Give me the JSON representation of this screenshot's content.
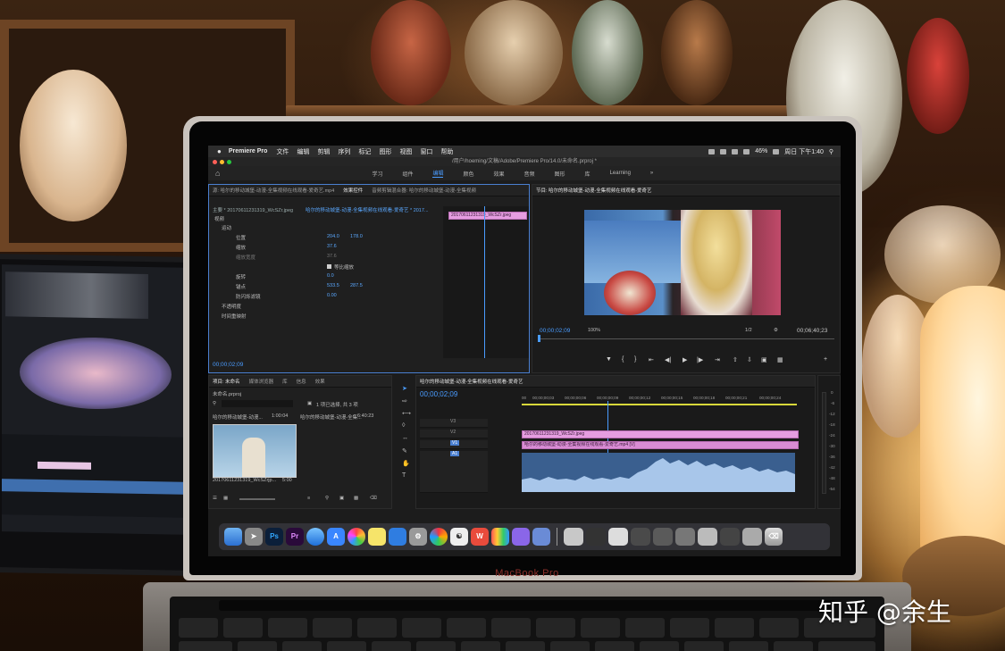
{
  "app": {
    "name": "Premiere Pro",
    "menus": [
      "文件",
      "编辑",
      "剪辑",
      "序列",
      "标记",
      "图形",
      "视图",
      "窗口",
      "帮助"
    ],
    "status_clock": "周日 下午1:40",
    "battery": "46%",
    "window_title": "/用户/hoeming/文稿/Adobe/Premiere Pro/14.0/未命名.prproj *"
  },
  "workspaces": {
    "items": [
      "学习",
      "组件",
      "编辑",
      "颜色",
      "效果",
      "音频",
      "图形",
      "库",
      "Learning"
    ],
    "active": "编辑"
  },
  "effect_controls": {
    "tabs": [
      "源: 哈尔的移动城堡-动漫-全集视频在线观看-爱奇艺.mp4",
      "效果控件",
      "音频剪辑混合器: 哈尔的移动城堡-动漫-全集视频"
    ],
    "active_tab": "效果控件",
    "master_clip": "主要 * 20170611231319_WcSZr.jpeg",
    "sequence_clip": "哈尔的移动城堡-动漫-全集视频在线观看-爱奇艺 * 2017...",
    "section_video": "视频",
    "motion": "运动",
    "position_label": "位置",
    "position_x": "204.0",
    "position_y": "178.0",
    "scale_label": "缩放",
    "scale_value": "37.6",
    "scale_width_label": "缩放宽度",
    "scale_width_value": "37.6",
    "uniform_scale": "等比缩放",
    "rotation_label": "旋转",
    "rotation_value": "0.0",
    "anchor_label": "锚点",
    "anchor_x": "533.5",
    "anchor_y": "287.5",
    "antiflicker_label": "防闪烁滤镜",
    "antiflicker_value": "0.00",
    "opacity": "不透明度",
    "time_remap": "时间重映射",
    "mini_clip": "20170611231319_WcSZr.jpeg",
    "timecode": "00;00;02;09"
  },
  "program_monitor": {
    "title": "节目: 哈尔的移动城堡-动漫-全集视频在线观看-爱奇艺",
    "timecode": "00;00;02;09",
    "zoom": "100%",
    "resolution": "1/2",
    "duration": "00;06;40;23"
  },
  "project_panel": {
    "tabs": [
      "项目: 未命名",
      "媒体浏览器",
      "库",
      "信息",
      "效果"
    ],
    "file": "未命名.prproj",
    "selection": "1 项已选择, 共 3 项",
    "items": [
      {
        "name": "哈尔的移动城堡-动漫...",
        "duration": "1:00:04"
      },
      {
        "name": "哈尔的移动城堡-动漫-全集...",
        "duration": "6:40:23"
      }
    ],
    "thumb_label": "20170611231319_WcSZrjp...",
    "thumb_duration": "5:00"
  },
  "timeline": {
    "title": "哈尔的移动城堡-动漫-全集视频在线观看-爱奇艺",
    "timecode": "00;00;02;09",
    "ticks": [
      "00",
      "00;00;00;03",
      "00;00;00;06",
      "00;00;00;09",
      "00;00;00;12",
      "00;00;00;15",
      "00;00;00;18",
      "00;00;00;21",
      "00;00;00;24"
    ],
    "tracks": [
      "V3",
      "V2",
      "V1",
      "A1"
    ],
    "clip_v2": "20170611231319_WcSZr.jpeg",
    "clip_v1": "哈尔的移动城堡-动漫-全集视频在线观看-爱奇艺.mp4 [V]"
  },
  "meter_labels": [
    "0",
    "-6",
    "-12",
    "-18",
    "-24",
    "-30",
    "-36",
    "-42",
    "-48",
    "-54"
  ],
  "laptop_brand": "MacBook Pro",
  "watermark": "知乎 @余生",
  "colors": {
    "accent": "#4a9cff",
    "clip_pink": "#e59de0",
    "audio_wave": "#7fa8d8"
  }
}
